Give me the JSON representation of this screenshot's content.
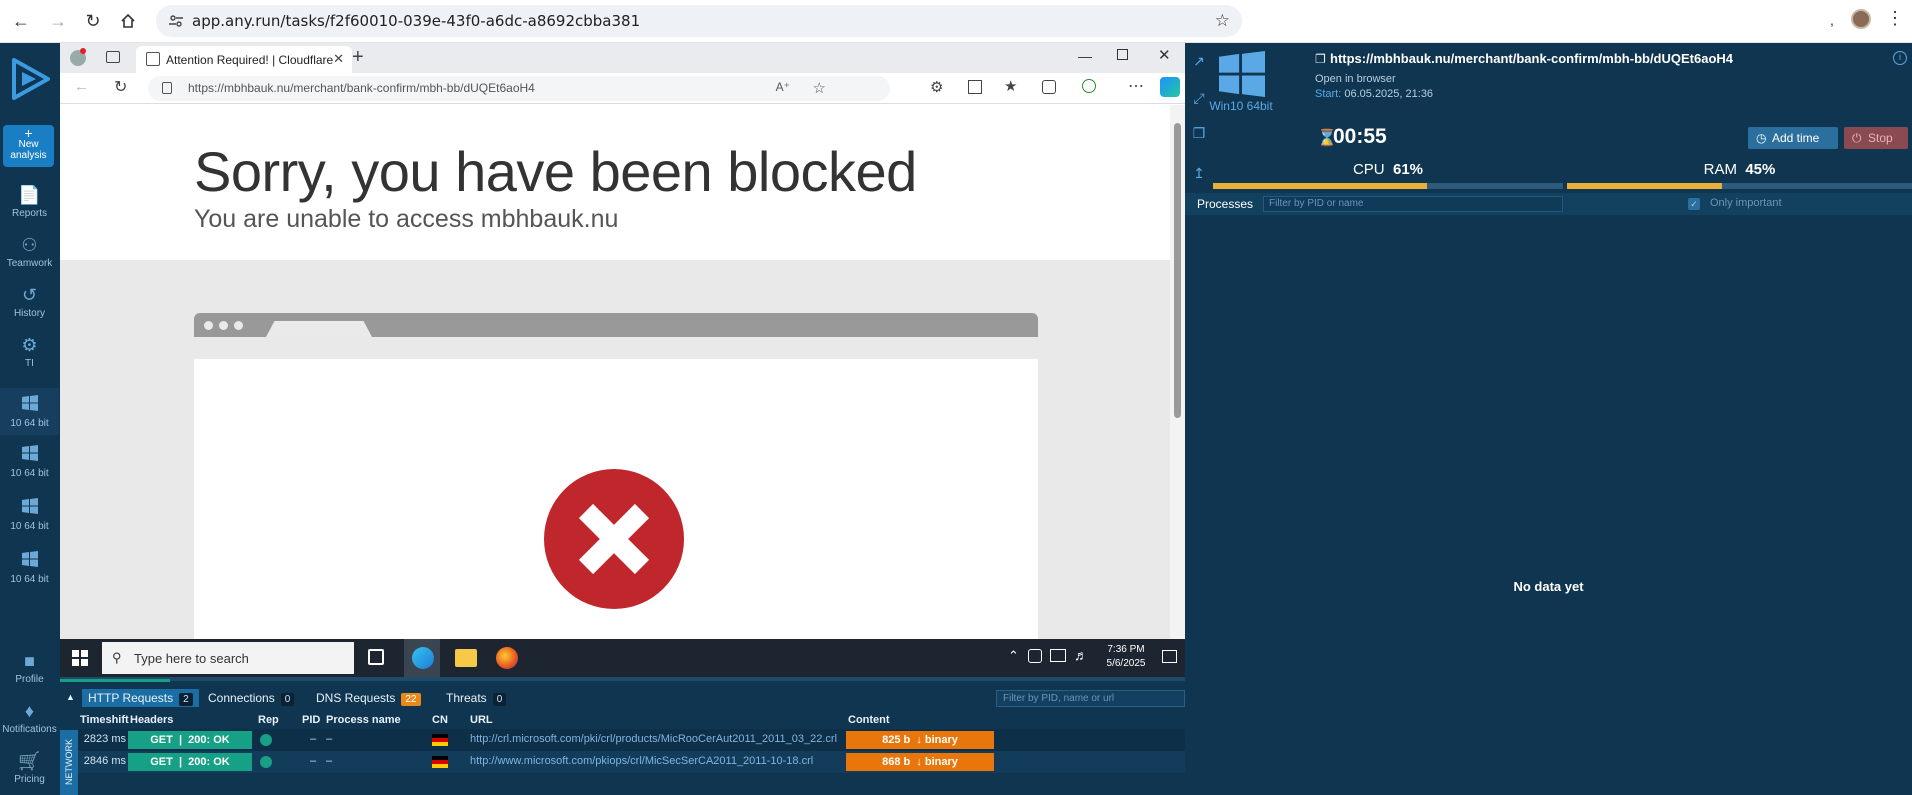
{
  "browser": {
    "url": "app.any.run/tasks/f2f60010-039e-43f0-a6dc-a8692cbba381",
    "separator": ","
  },
  "sidebar": {
    "items": [
      {
        "label": "New analysis",
        "icon": "plus-icon"
      },
      {
        "label": "Reports",
        "icon": "report-icon"
      },
      {
        "label": "Teamwork",
        "icon": "team-icon"
      },
      {
        "label": "History",
        "icon": "history-icon"
      },
      {
        "label": "TI",
        "icon": "ti-icon"
      },
      {
        "label": "10 64 bit",
        "icon": "windows-icon"
      },
      {
        "label": "10 64 bit",
        "icon": "windows-icon"
      },
      {
        "label": "10 64 bit",
        "icon": "windows-icon"
      },
      {
        "label": "10 64 bit",
        "icon": "windows-icon"
      },
      {
        "label": "Profile",
        "icon": "profile-icon"
      },
      {
        "label": "Notifications",
        "icon": "bell-icon"
      },
      {
        "label": "Pricing",
        "icon": "cart-icon"
      }
    ]
  },
  "vm": {
    "tab_title": "Attention Required! | Cloudflare",
    "address": "https://mbhbauk.nu/merchant/bank-confirm/mbh-bb/dUQEt6aoH4",
    "address_host": "mbhbauk.nu",
    "headline": "Sorry, you have been blocked",
    "subline": "You are unable to access mbhbauk.nu",
    "taskbar": {
      "search_placeholder": "Type here to search",
      "time": "7:36 PM",
      "date": "5/6/2025"
    }
  },
  "network": {
    "label": "NETWORK",
    "tabs": [
      {
        "label": "HTTP Requests",
        "count": "2"
      },
      {
        "label": "Connections",
        "count": "0"
      },
      {
        "label": "DNS Requests",
        "count": "22"
      },
      {
        "label": "Threats",
        "count": "0"
      }
    ],
    "filter_placeholder": "Filter by PID, name or url",
    "columns": [
      "Timeshift",
      "Headers",
      "Rep",
      "PID",
      "Process name",
      "CN",
      "URL",
      "Content"
    ],
    "rows": [
      {
        "timeshift": "2823 ms",
        "method": "GET",
        "status": "200: OK",
        "pid": "–",
        "process": "–",
        "url": "http://crl.microsoft.com/pki/crl/products/MicRooCerAut2011_2011_03_22.crl",
        "size": "825 b",
        "type": "binary"
      },
      {
        "timeshift": "2846 ms",
        "method": "GET",
        "status": "200: OK",
        "pid": "–",
        "process": "–",
        "url": "http://www.microsoft.com/pkiops/crl/MicSecSerCA2011_2011-10-18.crl",
        "size": "868 b",
        "type": "binary"
      }
    ]
  },
  "task": {
    "os": "Win10 64bit",
    "url": "https://mbhbauk.nu/merchant/bank-confirm/mbh-bb/dUQEt6aoH4",
    "open_in_browser": "Open in browser",
    "start_label": "Start:",
    "start_value": "06.05.2025, 21:36",
    "timer": "00:55",
    "add_time": "Add time",
    "stop": "Stop",
    "cpu_label": "CPU",
    "cpu_value": "61%",
    "cpu_fraction": 0.61,
    "ram_label": "RAM",
    "ram_value": "45%",
    "ram_fraction": 0.45,
    "processes_label": "Processes",
    "processes_filter": "Filter by PID or name",
    "only_important": "Only important",
    "empty": "No data yet"
  },
  "colors": {
    "panel_bg": "#0f3550",
    "accent": "#1a6ea4",
    "ok_green": "#16a085",
    "content_orange": "#e8760b",
    "usage_bar": "#e8b038",
    "blocked_red": "#c0272d"
  }
}
